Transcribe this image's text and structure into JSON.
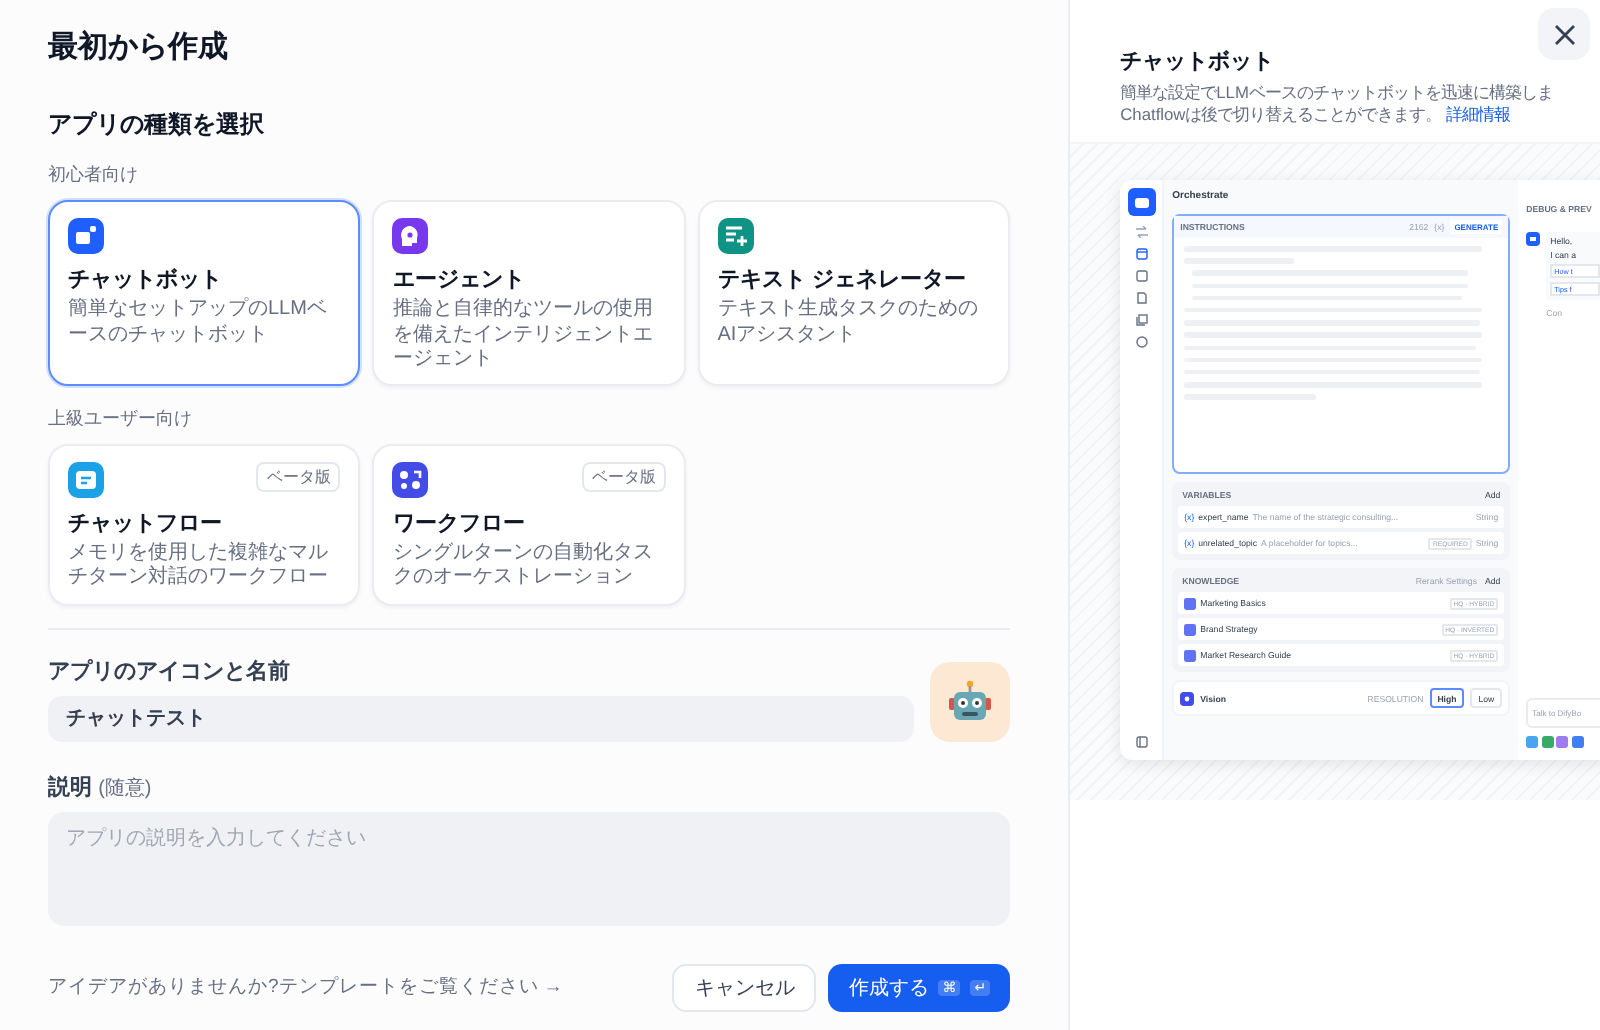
{
  "dialog": {
    "title": "最初から作成"
  },
  "app_type": {
    "heading": "アプリの種類を選択",
    "groups": [
      {
        "label": "初心者向け",
        "cards": [
          {
            "kind": "chatbot",
            "title": "チャットボット",
            "description": "簡単なセットアップのLLMベースのチャットボット",
            "color": "#1f5fff",
            "selected": true
          },
          {
            "kind": "agent",
            "title": "エージェント",
            "description": "推論と自律的なツールの使用を備えたインテリジェントエージェント",
            "color": "#7839ee",
            "selected": false
          },
          {
            "kind": "text_generator",
            "title": "テキスト ジェネレーター",
            "description": "テキスト生成タスクのためのAIアシスタント",
            "color": "#0e9384",
            "selected": false
          }
        ]
      },
      {
        "label": "上級ユーザー向け",
        "cards": [
          {
            "kind": "chatflow",
            "title": "チャットフロー",
            "description": "メモリを使用した複雑なマルチターン対話のワークフロー",
            "color": "#1ba1e6",
            "selected": false,
            "badge": "ベータ版"
          },
          {
            "kind": "workflow",
            "title": "ワークフロー",
            "description": "シングルターンの自動化タスクのオーケストレーション",
            "color": "#444ce7",
            "selected": false,
            "badge": "ベータ版"
          }
        ]
      }
    ]
  },
  "name_field": {
    "label": "アプリのアイコンと名前",
    "value": "チャットテスト"
  },
  "description_field": {
    "label": "説明",
    "optional": "(随意)",
    "placeholder": "アプリの説明を入力してください"
  },
  "footer": {
    "template_link": "アイデアがありませんか?テンプレートをご覧ください",
    "arrow": "→",
    "buttons": [
      {
        "kind": "secondary",
        "label": "キャンセル"
      },
      {
        "kind": "primary",
        "label": "作成する",
        "shortcut": [
          "⌘",
          "↵"
        ]
      }
    ]
  },
  "info_panel": {
    "title": "チャットボット",
    "description_lines": [
      "簡単な設定でLLMベースのチャットボットを迅速に構築しま",
      "Chatflowは後で切り替えることができます。"
    ],
    "link": "詳細情報",
    "preview": {
      "title": "Orchestrate",
      "instructions": {
        "label": "INSTRUCTIONS",
        "count": "2162",
        "var": "{x}",
        "generate": "GENERATE"
      },
      "variables": {
        "label": "VARIABLES",
        "add": "Add",
        "items": [
          {
            "marker": "{x}",
            "name": "expert_name",
            "description": "The name of the strategic consulting...",
            "type": "String"
          },
          {
            "marker": "{x}",
            "name": "unrelated_topic",
            "description": "A placeholder for topics...",
            "tag": "REQUIRED",
            "type": "String"
          }
        ]
      },
      "knowledge": {
        "label": "KNOWLEDGE",
        "rerank": "Rerank Settings",
        "add": "Add",
        "items": [
          {
            "name": "Marketing Basics",
            "tag": "HQ · HYBRID"
          },
          {
            "name": "Brand Strategy",
            "tag": "HQ · INVERTED"
          },
          {
            "name": "Market Research Guide",
            "tag": "HQ · HYBRID"
          }
        ]
      },
      "vision": {
        "label": "Vision",
        "resolution_label": "RESOLUTION",
        "options": [
          {
            "label": "High",
            "selected": true
          },
          {
            "label": "Low",
            "selected": false
          }
        ]
      },
      "debug": {
        "title": "DEBUG & PREV",
        "message_lines": [
          "Hello,",
          "I can a"
        ],
        "suggestions": [
          "How t",
          "Tips f"
        ],
        "note": "Con",
        "input_placeholder": "Talk to DifyBo"
      }
    }
  }
}
